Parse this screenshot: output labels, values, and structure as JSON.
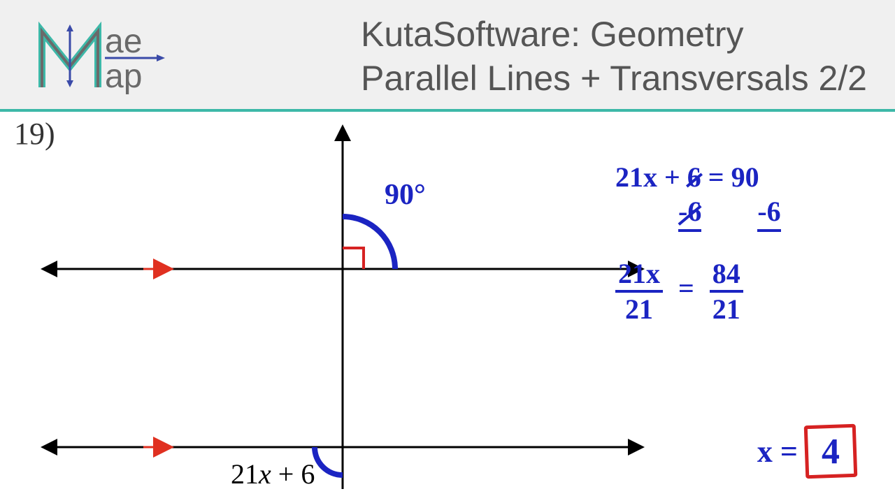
{
  "header": {
    "brand_line1": "ae",
    "brand_line2": "ap",
    "title_line1": "KutaSoftware: Geometry",
    "title_line2": "Parallel Lines + Transversals 2/2"
  },
  "problem": {
    "number": "19)",
    "expression": "21x + 6",
    "right_angle_label": "90°"
  },
  "work": {
    "eq1_lhs": "21x + 6",
    "eq1_eq": "=",
    "eq1_rhs": "90",
    "sub_lhs": "-6",
    "sub_rhs": "-6",
    "eq2_top_lhs": "21x",
    "eq2_bot_lhs": "21",
    "eq2_eq": "=",
    "eq2_top_rhs": "84",
    "eq2_bot_rhs": "21",
    "ans_lhs": "x =",
    "ans_val": "4"
  }
}
